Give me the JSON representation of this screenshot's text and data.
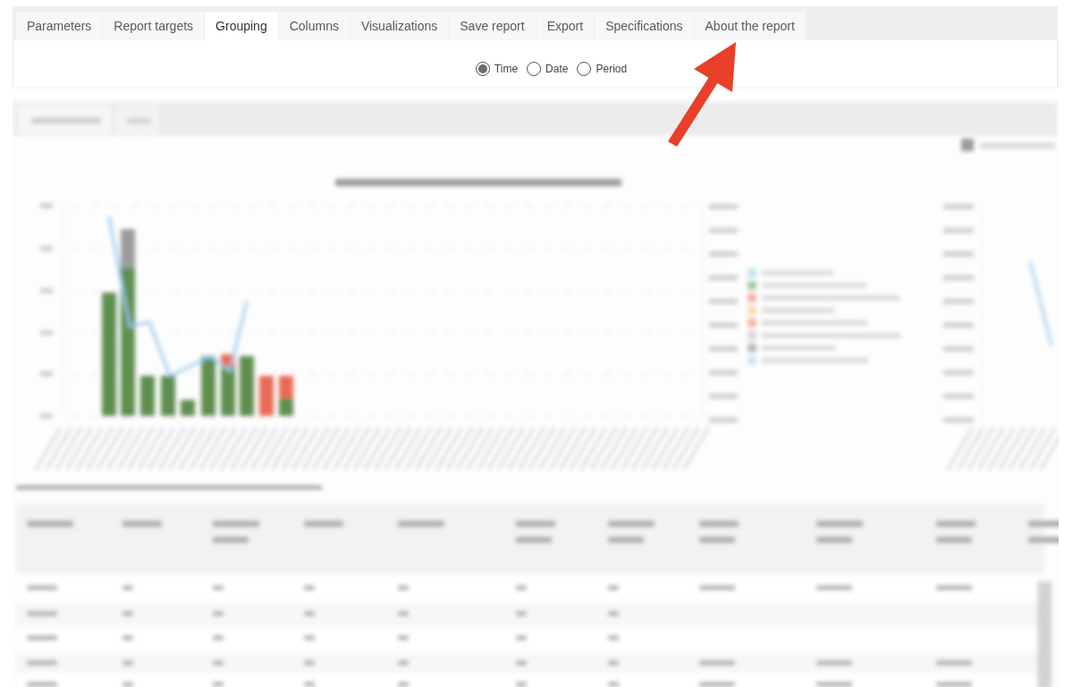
{
  "tabs": [
    {
      "label": "Parameters",
      "selected": false
    },
    {
      "label": "Report targets",
      "selected": false
    },
    {
      "label": "Grouping",
      "selected": true
    },
    {
      "label": "Columns",
      "selected": false
    },
    {
      "label": "Visualizations",
      "selected": false
    },
    {
      "label": "Save report",
      "selected": false
    },
    {
      "label": "Export",
      "selected": false
    },
    {
      "label": "Specifications",
      "selected": false
    },
    {
      "label": "About the report",
      "selected": false
    }
  ],
  "grouping_options": [
    {
      "label": "Time",
      "selected": true
    },
    {
      "label": "Date",
      "selected": false
    },
    {
      "label": "Period",
      "selected": false
    }
  ]
}
